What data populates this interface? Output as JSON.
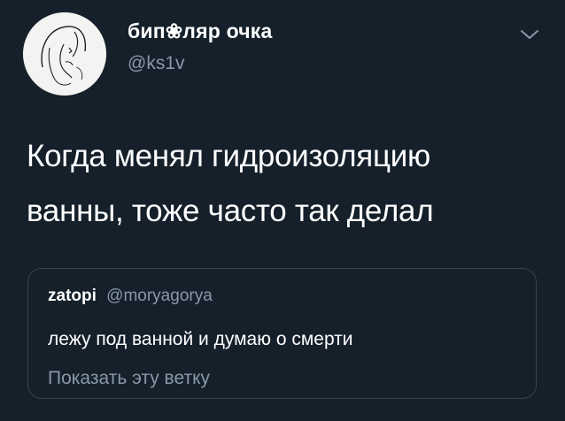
{
  "author": {
    "display_name": "бип❀ляр очка",
    "handle": "@ks1v",
    "avatar_icon": "avatar-sketch-icon"
  },
  "menu": {
    "icon": "chevron-down-icon"
  },
  "tweet": {
    "text": "Когда менял гидроизоляцию\nванны, тоже часто так делал"
  },
  "quote": {
    "display_name": "zatopi",
    "handle": "@moryagorya",
    "text": "лежу под ванной и думаю о смерти",
    "thread_link": "Показать эту ветку"
  },
  "colors": {
    "background": "#15202b",
    "secondary_text": "#8899a6",
    "border": "#38444d"
  }
}
